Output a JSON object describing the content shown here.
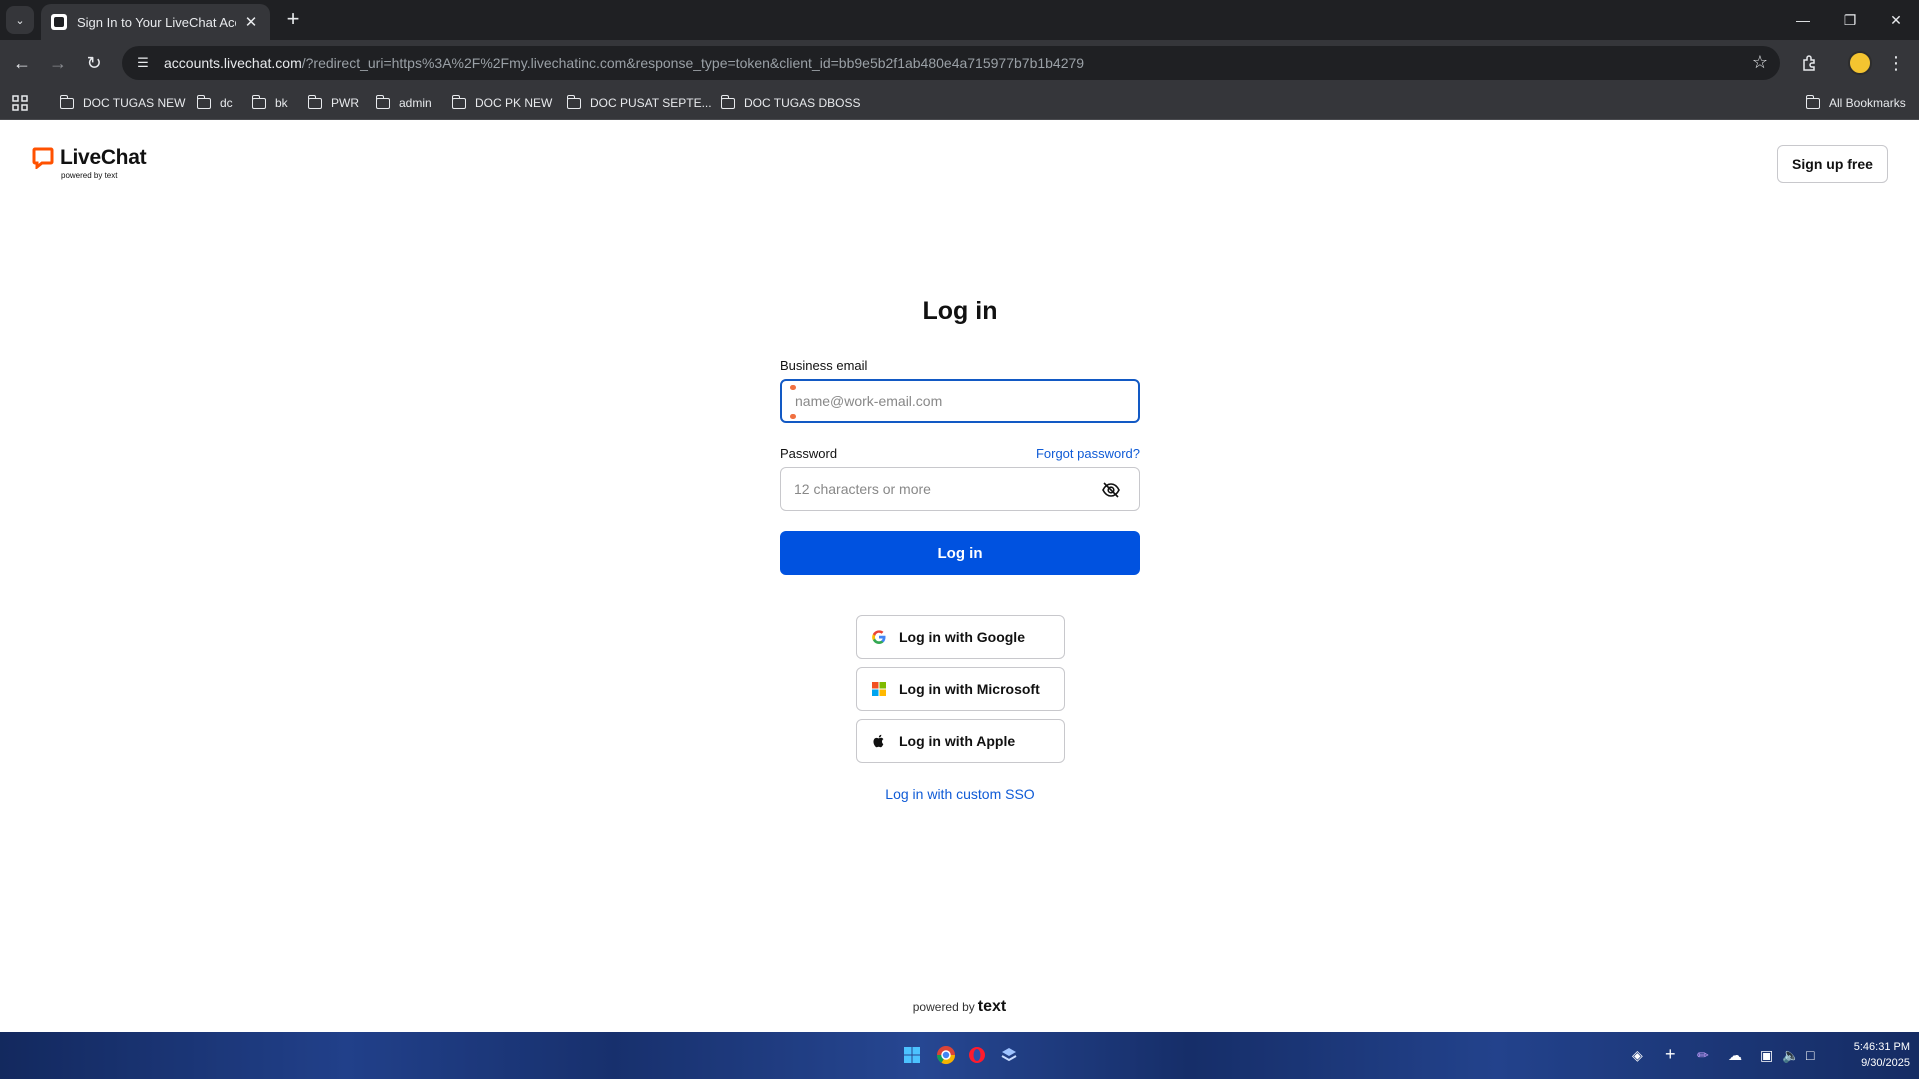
{
  "browser": {
    "tab_title": "Sign In to Your LiveChat Account",
    "url_host": "accounts.livechat.com",
    "url_rest": "/?redirect_uri=https%3A%2F%2Fmy.livechatinc.com&response_type=token&client_id=bb9e5b2f1ab480e4a715977b7b1b4279",
    "bookmarks": [
      "DOC TUGAS NEW",
      "dc",
      "bk",
      "PWR",
      "admin",
      "DOC PK NEW",
      "DOC PUSAT SEPTE...",
      "DOC TUGAS DBOSS"
    ],
    "all_bookmarks": "All Bookmarks"
  },
  "header": {
    "logo_name": "LiveChat",
    "logo_powered": "powered by text",
    "signup_label": "Sign up free"
  },
  "form": {
    "title": "Log in",
    "email_label": "Business email",
    "email_placeholder": "name@work-email.com",
    "password_label": "Password",
    "forgot_label": "Forgot password?",
    "password_placeholder": "12 characters or more",
    "login_label": "Log in",
    "google_label": "Log in with Google",
    "microsoft_label": "Log in with Microsoft",
    "apple_label": "Log in with Apple",
    "custom_sso_label": "Log in with custom SSO"
  },
  "footer": {
    "powered_by": "powered by",
    "brand": "text"
  },
  "taskbar": {
    "time": "5:46:31 PM",
    "date": "9/30/2025"
  },
  "colors": {
    "primary_button": "#0052e0",
    "link": "#0f5bd6",
    "focus_border": "#1259c4",
    "brand_orange": "#ff5100"
  }
}
